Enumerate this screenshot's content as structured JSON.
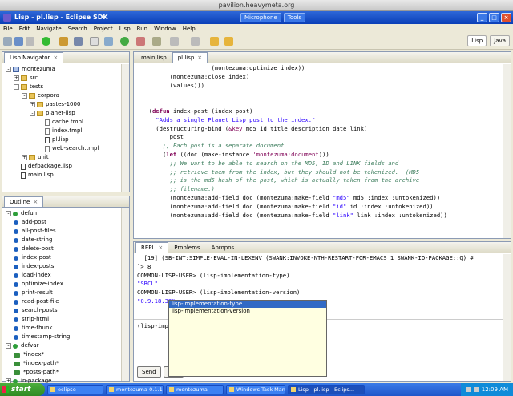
{
  "vnc_title": "pavilion.heavymeta.org",
  "window": {
    "title": "Lisp - pl.lisp - Eclipse SDK",
    "mid_buttons": [
      "Microphone",
      "Tools"
    ],
    "controls": [
      "_",
      "□",
      "×"
    ]
  },
  "menu": [
    "File",
    "Edit",
    "Navigate",
    "Search",
    "Project",
    "Lisp",
    "Run",
    "Window",
    "Help"
  ],
  "perspectives": [
    {
      "label": "Lisp",
      "active": true
    },
    {
      "label": "Java",
      "active": false
    }
  ],
  "navigator": {
    "tab_label": "Lisp Navigator",
    "items": [
      {
        "indent": 0,
        "type": "project",
        "label": "montezuma",
        "toggle": "-"
      },
      {
        "indent": 1,
        "type": "folder",
        "label": "src",
        "toggle": "+"
      },
      {
        "indent": 1,
        "type": "folder",
        "label": "tests",
        "toggle": "-"
      },
      {
        "indent": 2,
        "type": "folder",
        "label": "corpora",
        "toggle": "-"
      },
      {
        "indent": 3,
        "type": "folder",
        "label": "pastes-1000",
        "toggle": "+"
      },
      {
        "indent": 3,
        "type": "folder",
        "label": "planet-lisp",
        "toggle": "-"
      },
      {
        "indent": 4,
        "type": "file",
        "label": "cache.tmpl",
        "toggle": ""
      },
      {
        "indent": 4,
        "type": "file",
        "label": "index.tmpl",
        "toggle": ""
      },
      {
        "indent": 4,
        "type": "lisp",
        "label": "pl.lisp",
        "toggle": ""
      },
      {
        "indent": 4,
        "type": "file",
        "label": "web-search.tmpl",
        "toggle": ""
      },
      {
        "indent": 2,
        "type": "folder",
        "label": "unit",
        "toggle": "+"
      },
      {
        "indent": 1,
        "type": "lisp",
        "label": "defpackage.lisp",
        "toggle": ""
      },
      {
        "indent": 1,
        "type": "lisp",
        "label": "main.lisp",
        "toggle": ""
      }
    ]
  },
  "outline": {
    "tab_label": "Outline",
    "items": [
      {
        "indent": 0,
        "kind": "group",
        "label": "defun",
        "toggle": "-"
      },
      {
        "indent": 1,
        "kind": "fn",
        "label": "add-post"
      },
      {
        "indent": 1,
        "kind": "fn",
        "label": "all-post-files"
      },
      {
        "indent": 1,
        "kind": "fn",
        "label": "date-string"
      },
      {
        "indent": 1,
        "kind": "fn",
        "label": "delete-post"
      },
      {
        "indent": 1,
        "kind": "fn",
        "label": "index-post"
      },
      {
        "indent": 1,
        "kind": "fn",
        "label": "index-posts"
      },
      {
        "indent": 1,
        "kind": "fn",
        "label": "load-index"
      },
      {
        "indent": 1,
        "kind": "fn",
        "label": "optimize-index"
      },
      {
        "indent": 1,
        "kind": "fn",
        "label": "print-result"
      },
      {
        "indent": 1,
        "kind": "fn",
        "label": "read-post-file"
      },
      {
        "indent": 1,
        "kind": "fn",
        "label": "search-posts"
      },
      {
        "indent": 1,
        "kind": "fn",
        "label": "strip-html"
      },
      {
        "indent": 1,
        "kind": "fn",
        "label": "time-thunk"
      },
      {
        "indent": 1,
        "kind": "fn",
        "label": "timestamp-string"
      },
      {
        "indent": 0,
        "kind": "group",
        "label": "defvar",
        "toggle": "-"
      },
      {
        "indent": 1,
        "kind": "var",
        "label": "*index*"
      },
      {
        "indent": 1,
        "kind": "var",
        "label": "*index-path*"
      },
      {
        "indent": 1,
        "kind": "var",
        "label": "*posts-path*"
      },
      {
        "indent": 0,
        "kind": "group",
        "label": "in-package",
        "toggle": "+"
      }
    ]
  },
  "editor": {
    "tabs": [
      {
        "label": "main.lisp",
        "active": false
      },
      {
        "label": "pl.lisp",
        "active": true
      }
    ],
    "lines": [
      [
        [
          "p",
          "                    (montezuma:optimize index))"
        ]
      ],
      [
        [
          "p",
          "        (montezuma:close index)"
        ]
      ],
      [
        [
          "p",
          "        (values)))"
        ]
      ],
      [
        [
          "p",
          ""
        ]
      ],
      [
        [
          "p",
          ""
        ]
      ],
      [
        [
          "p",
          "  ("
        ],
        [
          "d",
          "defun"
        ],
        [
          "p",
          " index-post (index post)"
        ]
      ],
      [
        [
          "s",
          "    \"Adds a single Planet Lisp post to the index.\""
        ]
      ],
      [
        [
          "p",
          "    (destructuring-bind ("
        ],
        [
          "k",
          "&key"
        ],
        [
          "p",
          " md5 id title description date link)"
        ]
      ],
      [
        [
          "p",
          "        post"
        ]
      ],
      [
        [
          "c",
          "      ;; Each post is a separate document."
        ]
      ],
      [
        [
          "p",
          "      ("
        ],
        [
          "d",
          "let"
        ],
        [
          "p",
          " ((doc (make-instance "
        ],
        [
          "k",
          "'montezuma:document"
        ],
        [
          "p",
          ")))"
        ]
      ],
      [
        [
          "c",
          "        ;; We want to be able to search on the MD5, ID and LINK fields and"
        ]
      ],
      [
        [
          "c",
          "        ;; retrieve them from the index, but they should not be tokenized.  (MD5"
        ]
      ],
      [
        [
          "c",
          "        ;; is the md5 hash of the post, which is actually taken from the archive"
        ]
      ],
      [
        [
          "c",
          "        ;; filename.)"
        ]
      ],
      [
        [
          "p",
          "        (montezuma:add-field doc (montezuma:make-field "
        ],
        [
          "s",
          "\"md5\""
        ],
        [
          "p",
          " md5 :index :untokenized))"
        ]
      ],
      [
        [
          "p",
          "        (montezuma:add-field doc (montezuma:make-field "
        ],
        [
          "s",
          "\"id\""
        ],
        [
          "p",
          " id :index :untokenized))"
        ]
      ],
      [
        [
          "p",
          "        (montezuma:add-field doc (montezuma:make-field "
        ],
        [
          "s",
          "\"link\""
        ],
        [
          "p",
          " link :index :untokenized))"
        ]
      ]
    ]
  },
  "repl": {
    "tabs": [
      {
        "label": "REPL",
        "active": true
      },
      {
        "label": "Problems",
        "active": false
      },
      {
        "label": "Apropos",
        "active": false
      }
    ],
    "output": [
      {
        "text": "  [19] (SB-INT:SIMPLE-EVAL-IN-LEXENV (SWANK:INVOKE-NTH-RESTART-FOR-EMACS 1 SWANK-IO-PACKAGE::Q) #",
        "cls": "p"
      },
      {
        "text": "]> 8",
        "cls": "p"
      },
      {
        "text": "COMMON-LISP-USER> (lisp-implementation-type)",
        "cls": "p"
      },
      {
        "text": "\"SBCL\"",
        "cls": "s"
      },
      {
        "text": "COMMON-LISP-USER> (lisp-implementation-version)",
        "cls": "p"
      },
      {
        "text": "\"0.9.18.33\"",
        "cls": "s"
      }
    ],
    "input": "(lisp-imp",
    "buttons": [
      "Send",
      "Hist"
    ]
  },
  "autocomplete": {
    "items": [
      "lisp-implementation-type",
      "lisp-implementation-version"
    ],
    "selected": 0
  },
  "taskbar": {
    "start": "start",
    "tasks": [
      {
        "label": "eclipse",
        "active": false
      },
      {
        "label": "montezuma-0.1.1",
        "active": false
      },
      {
        "label": "montezuma",
        "active": false
      },
      {
        "label": "Windows Task Man...",
        "active": false
      },
      {
        "label": "Lisp - pl.lisp - Eclips...",
        "active": true
      }
    ],
    "clock": "12:09 AM"
  }
}
